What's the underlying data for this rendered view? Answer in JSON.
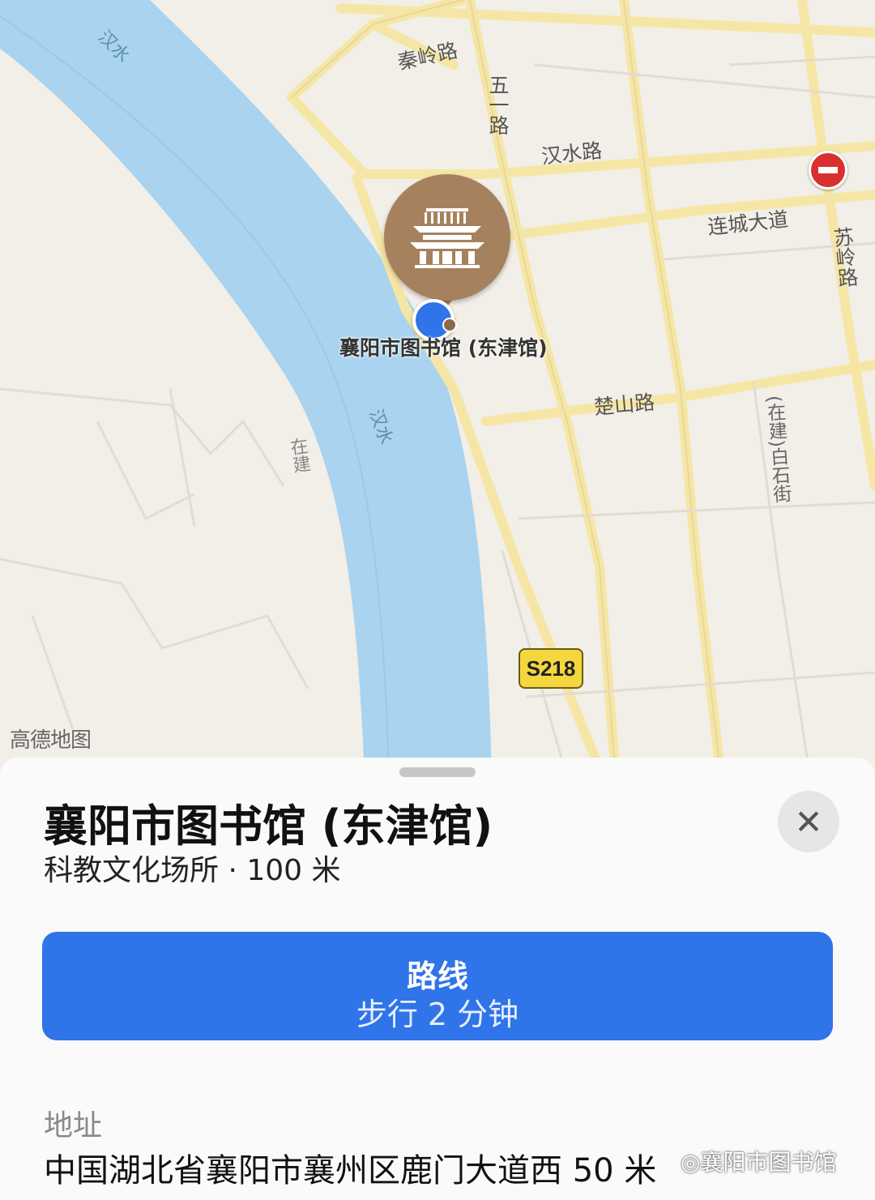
{
  "map": {
    "logo": "高德地图",
    "river_labels": [
      "汉水",
      "汉水"
    ],
    "roads": {
      "qinling": "秦岭路",
      "wuyi": "五一路",
      "hanshui": "汉水路",
      "liancheng": "连城大道",
      "suling": "苏岭路",
      "chushan": "楚山路",
      "zaijian_left": "在建",
      "baishi": "(在建)白石街"
    },
    "poi_label": "襄阳市图书馆 (东津馆)",
    "highway_badge": "S218",
    "icons": {
      "poi": "library-building-icon",
      "user_location": "user-location-icon",
      "no_entry": "no-entry-icon"
    },
    "colors": {
      "land": "#f2efe8",
      "river": "#a9d3ee",
      "road": "#f6e6a6",
      "poi": "#a5825d",
      "user_dot": "#2f74e8"
    }
  },
  "sheet": {
    "title": "襄阳市图书馆 (东津馆)",
    "subtitle": "科教文化场所 · 100 米",
    "close_label": "✕",
    "route_button": {
      "title": "路线",
      "subtitle": "步行 2 分钟",
      "color": "#2f74e8"
    },
    "address_label": "地址",
    "address_value": "中国湖北省襄阳市襄州区鹿门大道西 50 米",
    "watermark": "襄阳市图书馆"
  }
}
